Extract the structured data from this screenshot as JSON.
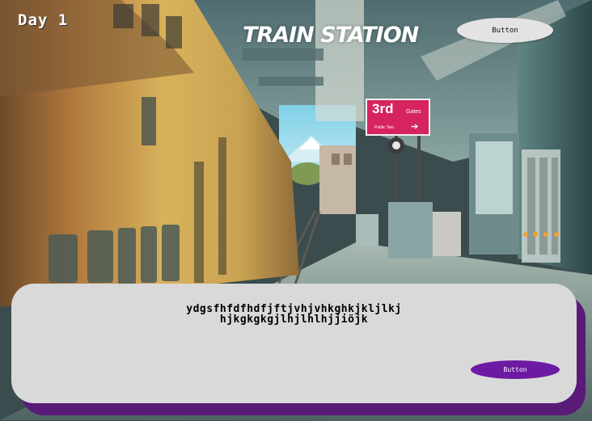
{
  "hud": {
    "day_label": "Day 1"
  },
  "scene": {
    "title": "TRAIN STATION",
    "sign_number": "3rd",
    "sign_word": "Gates",
    "sign_sub": "Public Taxi"
  },
  "top_button": {
    "label": "Button"
  },
  "dialog": {
    "line1": "ydgsfhfdfhdfjftjvhjvhkghkjkljlkj",
    "line2": "hjkgkgkgjlhjlhlhjjiöjk",
    "button_label": "Button"
  },
  "colors": {
    "dialog_bg": "#d9d9d9",
    "dialog_shadow": "#5a1a78",
    "dialog_button": "#6c1aa3",
    "top_button": "#e3e3e3",
    "sign": "#d5245e"
  }
}
